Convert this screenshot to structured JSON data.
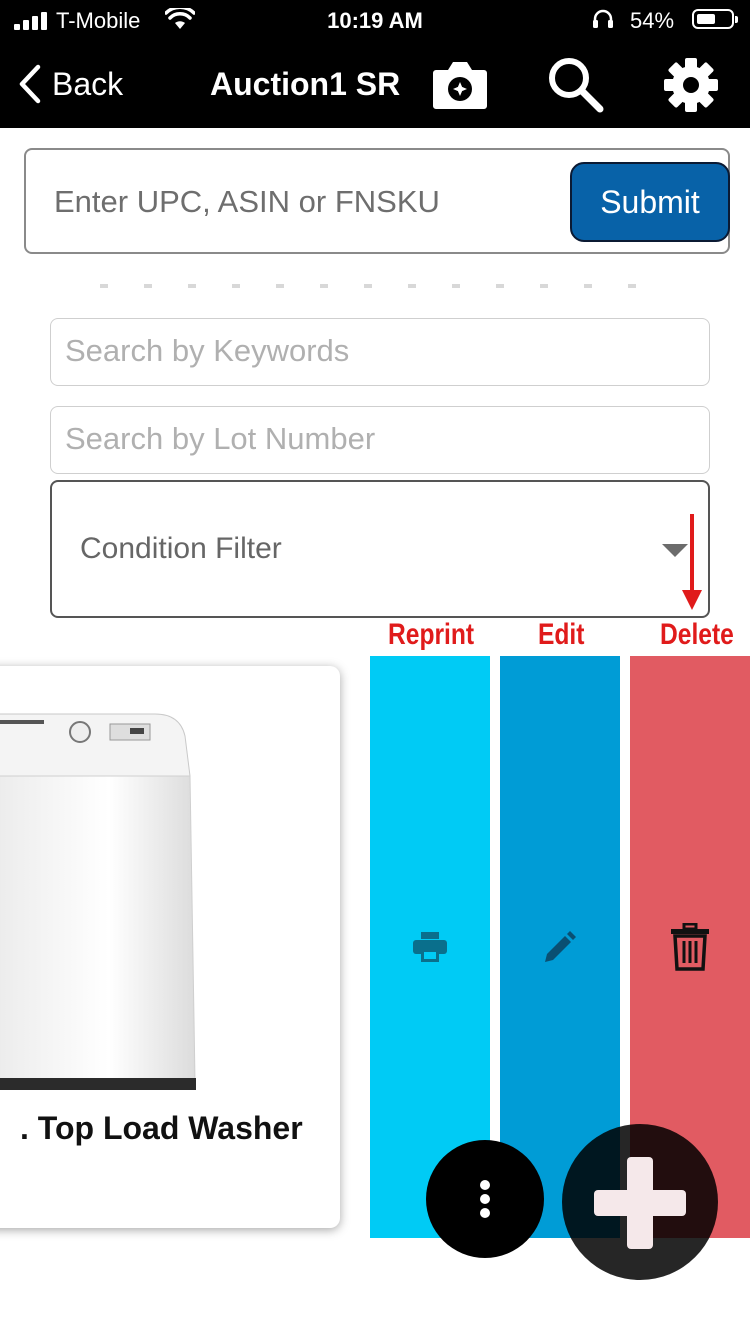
{
  "status_bar": {
    "carrier": "T-Mobile",
    "time": "10:19 AM",
    "battery_percent": "54%"
  },
  "nav": {
    "back_label": "Back",
    "title": "Auction1 SR"
  },
  "upc": {
    "placeholder": "Enter UPC, ASIN or FNSKU",
    "submit_label": "Submit"
  },
  "filters": {
    "keywords_placeholder": "Search by Keywords",
    "lot_placeholder": "Search by Lot Number",
    "condition_label": "Condition Filter"
  },
  "annotations": {
    "reprint": "Reprint",
    "edit": "Edit",
    "delete": "Delete"
  },
  "item": {
    "name": ". Top Load Washer"
  },
  "icons": {
    "camera": "camera-icon",
    "search": "search-icon",
    "settings": "gear-icon",
    "reprint": "printer-icon",
    "edit": "pencil-icon",
    "delete": "trash-icon",
    "menu": "more-vertical-icon",
    "add": "plus-icon"
  },
  "colors": {
    "submit": "#0862a8",
    "reprint": "#00cbf5",
    "edit": "#009cd6",
    "delete": "#e15b62",
    "annotation": "#e01b1b"
  }
}
